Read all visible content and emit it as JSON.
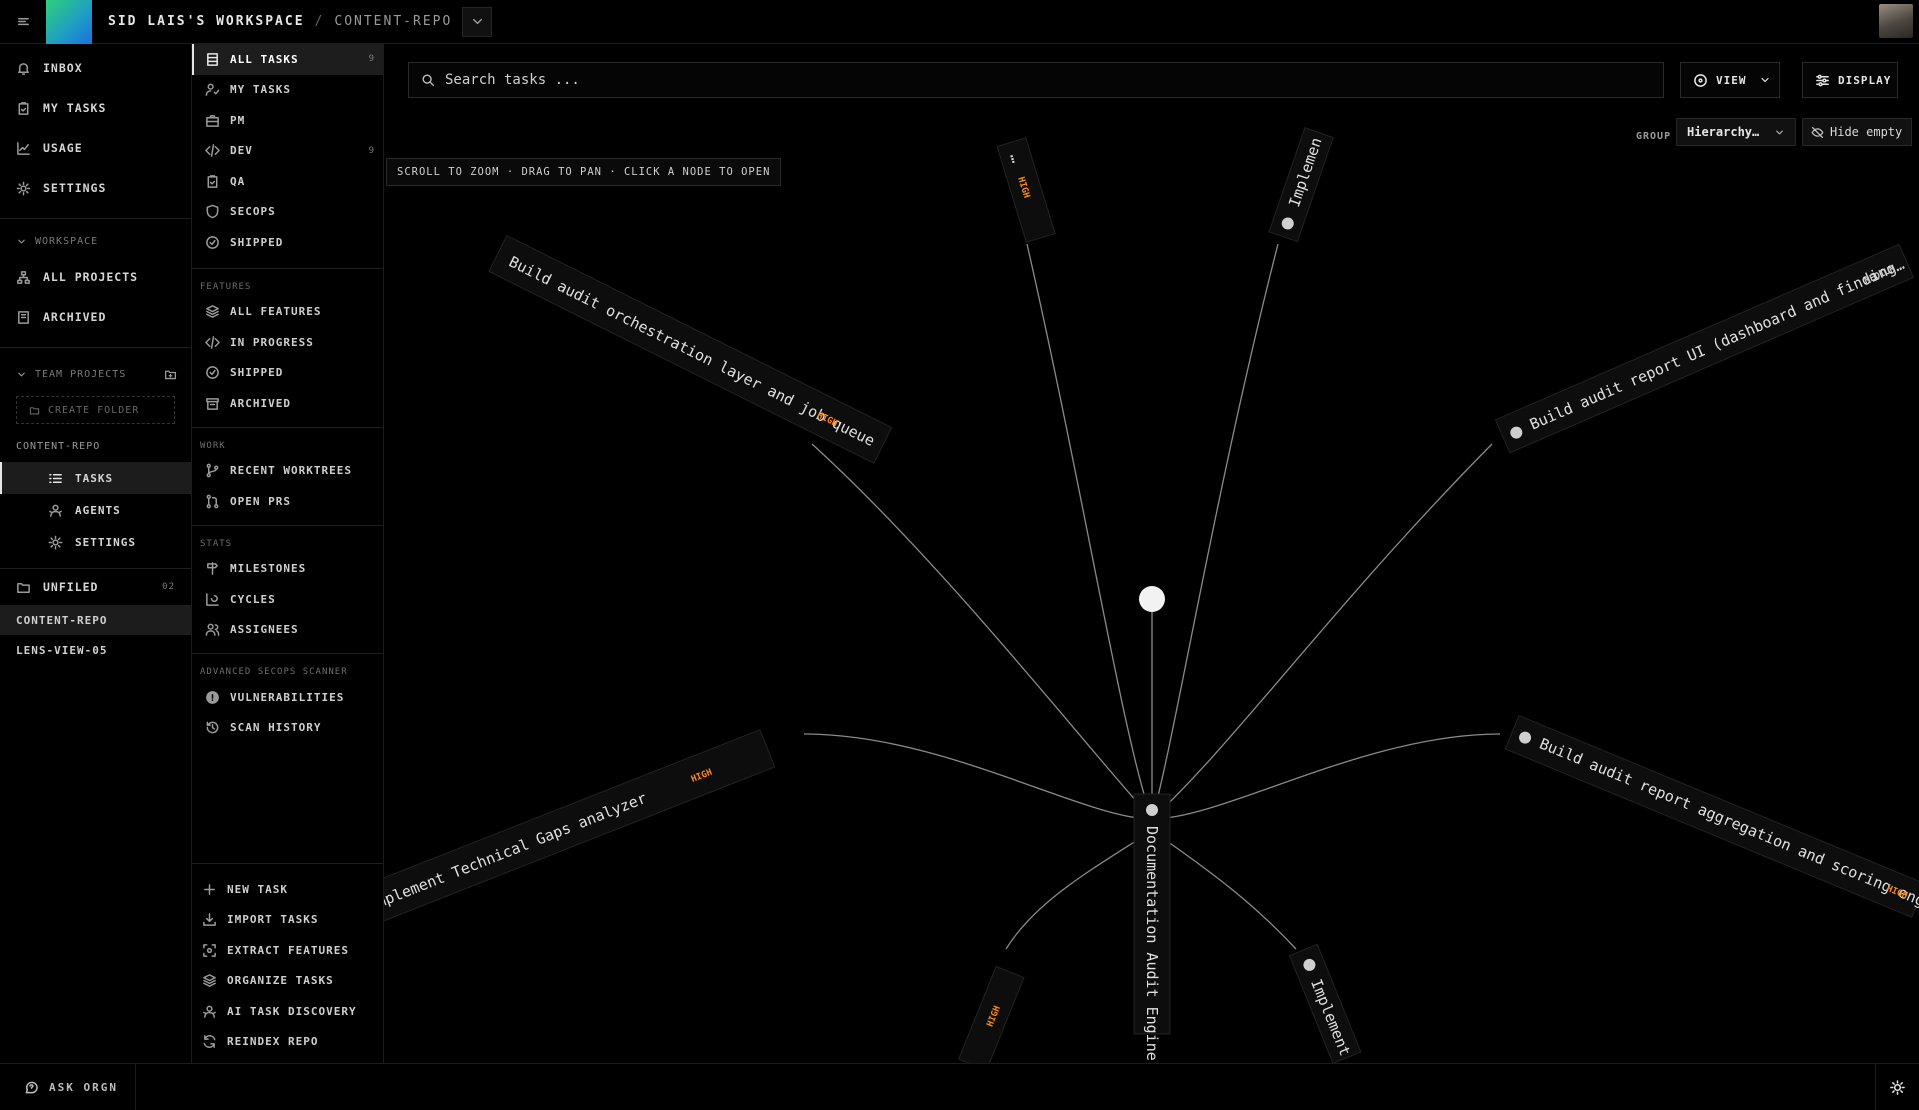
{
  "header": {
    "workspace": "SID LAIS'S WORKSPACE",
    "separator": "/",
    "repo": "CONTENT-REPO"
  },
  "sidebar": {
    "top": [
      {
        "label": "INBOX",
        "icon": "bell-icon"
      },
      {
        "label": "MY TASKS",
        "icon": "clipboard-icon"
      },
      {
        "label": "USAGE",
        "icon": "chart-line-icon"
      },
      {
        "label": "SETTINGS",
        "icon": "gear-icon"
      }
    ],
    "workspace_label": "WORKSPACE",
    "workspace_items": [
      {
        "label": "ALL PROJECTS",
        "icon": "hierarchy-icon"
      },
      {
        "label": "ARCHIVED",
        "icon": "archive-icon"
      }
    ],
    "team_label": "TEAM PROJECTS",
    "create_folder": "CREATE FOLDER",
    "project_name": "CONTENT-REPO",
    "project_items": [
      {
        "label": "TASKS",
        "icon": "list-icon"
      },
      {
        "label": "AGENTS",
        "icon": "agents-icon"
      },
      {
        "label": "SETTINGS",
        "icon": "gear-icon"
      }
    ],
    "unfiled_label": "UNFILED",
    "unfiled_count": "02",
    "unfiled_items": [
      "CONTENT-REPO",
      "LENS-VIEW-05"
    ]
  },
  "nav": {
    "tasks": [
      {
        "label": "ALL TASKS",
        "count": "9",
        "icon": "stack-icon"
      },
      {
        "label": "MY TASKS",
        "count": "",
        "icon": "user-check-icon"
      },
      {
        "label": "PM",
        "count": "",
        "icon": "briefcase-icon"
      },
      {
        "label": "DEV",
        "count": "9",
        "icon": "code-icon"
      },
      {
        "label": "QA",
        "count": "",
        "icon": "clipboard-check-icon"
      },
      {
        "label": "SECOPS",
        "count": "",
        "icon": "shield-icon"
      },
      {
        "label": "SHIPPED",
        "count": "",
        "icon": "check-circle-icon"
      }
    ],
    "features_label": "FEATURES",
    "features": [
      {
        "label": "ALL FEATURES",
        "icon": "layers-icon"
      },
      {
        "label": "IN PROGRESS",
        "icon": "code-icon"
      },
      {
        "label": "SHIPPED",
        "icon": "check-circle-icon"
      },
      {
        "label": "ARCHIVED",
        "icon": "archive-icon"
      }
    ],
    "work_label": "WORK",
    "work": [
      {
        "label": "RECENT WORKTREES",
        "icon": "git-branch-icon"
      },
      {
        "label": "OPEN PRS",
        "icon": "git-pull-request-icon"
      }
    ],
    "stats_label": "STATS",
    "stats": [
      {
        "label": "MILESTONES",
        "icon": "milestone-icon"
      },
      {
        "label": "CYCLES",
        "icon": "cycle-chart-icon"
      },
      {
        "label": "ASSIGNEES",
        "icon": "users-icon"
      }
    ],
    "scanner_label": "ADVANCED SECOPS SCANNER",
    "scanner": [
      {
        "label": "VULNERABILITIES",
        "icon": "alert-icon"
      },
      {
        "label": "SCAN HISTORY",
        "icon": "history-icon"
      }
    ],
    "actions": [
      {
        "label": "NEW TASK",
        "icon": "plus-icon"
      },
      {
        "label": "IMPORT TASKS",
        "icon": "download-icon"
      },
      {
        "label": "EXTRACT FEATURES",
        "icon": "scan-icon"
      },
      {
        "label": "ORGANIZE TASKS",
        "icon": "layers-icon"
      },
      {
        "label": "AI TASK DISCOVERY",
        "icon": "sparkle-icon"
      },
      {
        "label": "REINDEX REPO",
        "icon": "refresh-icon"
      }
    ]
  },
  "toolbar": {
    "search_placeholder": "Search tasks ...",
    "view_label": "VIEW",
    "display_label": "DISPLAY",
    "group_label": "GROUP",
    "group_value": "Hierarchy…",
    "hide_empty_label": "Hide empty"
  },
  "graph": {
    "hint": "SCROLL TO ZOOM · DRAG TO PAN · CLICK A NODE TO OPEN",
    "center_label": "Documentation Audit Engine",
    "nodes": [
      {
        "label": "Build audit orchestration layer and job queue",
        "priority": "HIGH"
      },
      {
        "label": "…",
        "priority": "HIGH"
      },
      {
        "label": "Implemen",
        "priority": ""
      },
      {
        "label": "Build audit report UI (dashboard and finding…",
        "priority": "MEDIUM"
      },
      {
        "label": "Build audit report aggregation and scoring eng…",
        "priority": "HIGH"
      },
      {
        "label": "Implement",
        "priority": ""
      },
      {
        "label": "",
        "priority": "HIGH"
      },
      {
        "label": "mplement Technical Gaps analyzer",
        "priority": "HIGH"
      }
    ]
  },
  "footer": {
    "ask_label": "ASK ORGN"
  },
  "colors": {
    "accent": "#ffffff",
    "priority_high": "#ff8a1e",
    "background": "#000000",
    "logo_gradient_start": "#2fd07a",
    "logo_gradient_end": "#1b6fe0"
  }
}
